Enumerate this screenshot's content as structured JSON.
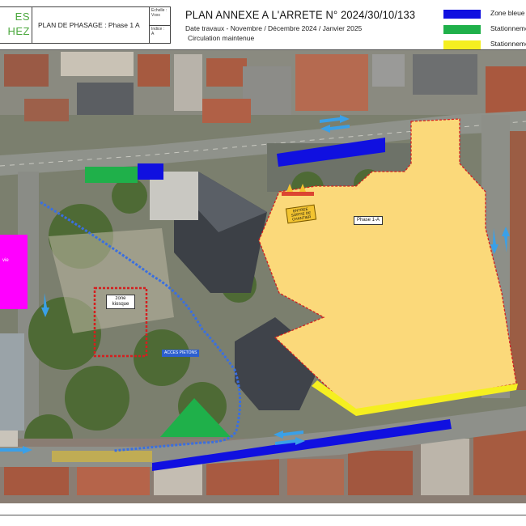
{
  "header": {
    "logo_line1": "ES",
    "logo_line2": "HEZ",
    "plan_title": "PLAN DE PHASAGE : Phase 1 A",
    "scale_label": "Echelle :",
    "scale_value": "Vxxx",
    "index_label": "Indice :",
    "index_value": "A",
    "main_title": "PLAN ANNEXE A L'ARRETE N° 2024/30/10/133",
    "dates": "Date travaux  - Novembre / Décembre 2024 / Janvier 2025",
    "circulation": "Circulation maintenue"
  },
  "legend": [
    {
      "color": "#1010e0",
      "label": "Zone bleue s"
    },
    {
      "color": "#1fb04a",
      "label": "Stationneme"
    },
    {
      "color": "#f5ef20",
      "label": "Stationneme"
    }
  ],
  "map": {
    "phase_label": "Phase 1-A",
    "kiosque_label": "zone kiosque",
    "pietons_label": "ACCES PIETONS",
    "sortie_label": "ENTREE SORTIE DE CHANTIER",
    "left_label": "vie",
    "colors": {
      "work_zone_fill": "#fbd97a",
      "work_zone_border": "#d41f1f",
      "blue_zone": "#1010e0",
      "green_zone": "#1fb04a",
      "yellow_zone": "#f5ef20",
      "pedestrian_path": "#3a6fe0",
      "magenta_zone": "#ff00ff",
      "arrow": "#3aa0e8"
    }
  }
}
